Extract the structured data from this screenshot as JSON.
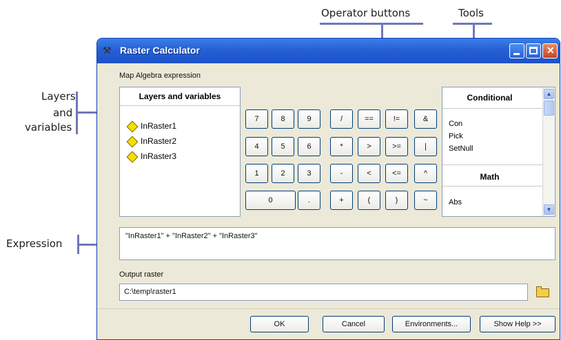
{
  "annotations": {
    "operator_buttons": "Operator buttons",
    "tools": "Tools",
    "layers_line1": "Layers",
    "layers_line2": "and",
    "layers_line3": "variables",
    "expression": "Expression"
  },
  "window": {
    "title": "Raster Calculator",
    "icon": "hammer-icon"
  },
  "map_algebra_label": "Map Algebra expression",
  "layers_panel": {
    "header": "Layers and variables",
    "items": [
      "InRaster1",
      "InRaster2",
      "InRaster3"
    ]
  },
  "operator_keys": [
    [
      "7",
      "8",
      "9",
      "/",
      "==",
      "!=",
      "&"
    ],
    [
      "4",
      "5",
      "6",
      "*",
      ">",
      ">=",
      "|"
    ],
    [
      "1",
      "2",
      "3",
      "-",
      "<",
      "<=",
      "^"
    ],
    [
      "0",
      ".",
      "+",
      "(",
      ")",
      "~"
    ]
  ],
  "tools_panel": {
    "header_conditional": "Conditional",
    "conditional_items": [
      "Con",
      "Pick",
      "SetNull"
    ],
    "header_math": "Math",
    "math_items": [
      "Abs"
    ]
  },
  "expression": "\"InRaster1\" + \"InRaster2\" + \"InRaster3\"",
  "output_raster": {
    "label": "Output raster",
    "value": "C:\\temp\\raster1"
  },
  "buttons": {
    "ok": "OK",
    "cancel": "Cancel",
    "environments": "Environments...",
    "show_help": "Show Help >>"
  },
  "colors": {
    "titlebar": "#2560d6",
    "window_body": "#ece9d8",
    "callout_line": "#6f78b8",
    "variable_diamond": "#f4e000"
  }
}
